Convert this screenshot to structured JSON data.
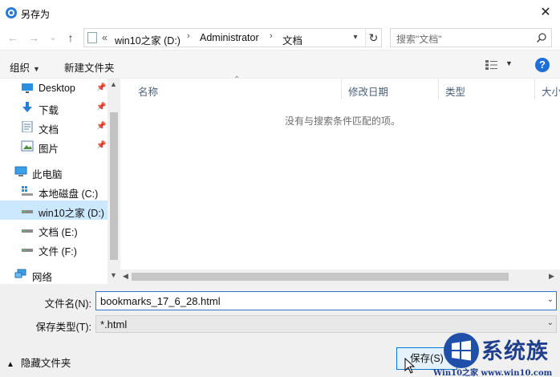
{
  "window": {
    "title": "另存为",
    "close_glyph": "✕"
  },
  "navigation": {
    "back_glyph": "←",
    "forward_glyph": "→",
    "recent_glyph": "⌄",
    "up_glyph": "↑",
    "address": {
      "overflow": "«",
      "segments": [
        "win10之家 (D:)",
        "Administrator",
        "文档"
      ],
      "separator": "›"
    },
    "search_placeholder": "搜索\"文档\""
  },
  "toolbar": {
    "organize_label": "组织",
    "new_folder_label": "新建文件夹",
    "help_label": "?"
  },
  "sidebar": {
    "items": [
      {
        "label": "Desktop",
        "icon": "desktop-icon",
        "pinned": true
      },
      {
        "label": "下载",
        "icon": "download-icon",
        "pinned": true
      },
      {
        "label": "文档",
        "icon": "documents-icon",
        "pinned": true
      },
      {
        "label": "图片",
        "icon": "pictures-icon",
        "pinned": true
      },
      {
        "label": "此电脑",
        "icon": "this-pc-icon",
        "pinned": false
      },
      {
        "label": "本地磁盘 (C:)",
        "icon": "windows-drive-icon",
        "pinned": false
      },
      {
        "label": "win10之家 (D:)",
        "icon": "drive-icon",
        "pinned": false,
        "selected": true
      },
      {
        "label": "文档 (E:)",
        "icon": "drive-icon",
        "pinned": false
      },
      {
        "label": "文件 (F:)",
        "icon": "drive-icon",
        "pinned": false
      },
      {
        "label": "网络",
        "icon": "network-icon",
        "pinned": false
      }
    ]
  },
  "file_list": {
    "columns": [
      "名称",
      "修改日期",
      "类型",
      "大小"
    ],
    "empty_message": "没有与搜索条件匹配的项。"
  },
  "form": {
    "filename_label": "文件名(N):",
    "filename_value": "bookmarks_17_6_28.html",
    "filetype_label": "保存类型(T):",
    "filetype_value": "*.html"
  },
  "footer": {
    "hide_folders_label": "隐藏文件夹",
    "save_label": "保存(S)"
  },
  "watermark": {
    "title": "系统族",
    "subtitle": "Win10之家 www.win10.com"
  },
  "colors": {
    "accent": "#0078d7",
    "selection": "#cce8ff",
    "help": "#1e6fd8"
  }
}
